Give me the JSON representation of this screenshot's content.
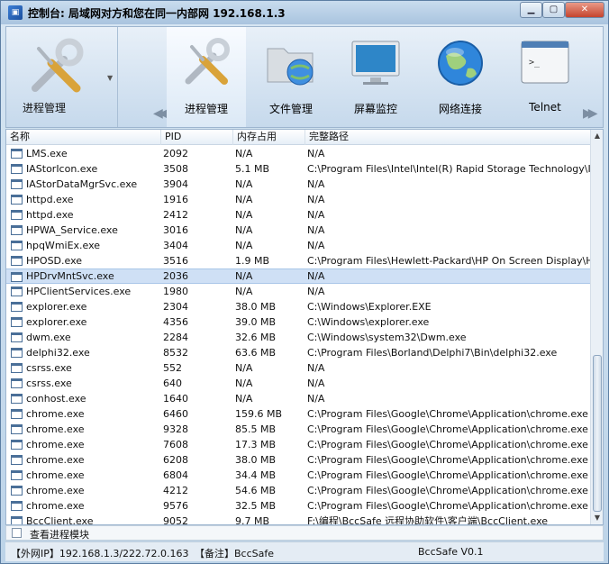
{
  "window": {
    "title": "控制台: 局域网对方和您在同一内部网   192.168.1.3"
  },
  "toolbar": {
    "main_tool": {
      "label": "进程管理",
      "icon": "tools-icon"
    },
    "tools": [
      {
        "label": "进程管理",
        "icon": "tools-icon",
        "selected": true
      },
      {
        "label": "文件管理",
        "icon": "folder-globe-icon",
        "selected": false
      },
      {
        "label": "屏幕监控",
        "icon": "monitor-icon",
        "selected": false
      },
      {
        "label": "网络连接",
        "icon": "globe-icon",
        "selected": false
      },
      {
        "label": "Telnet",
        "icon": "terminal-icon",
        "selected": false
      }
    ]
  },
  "table": {
    "columns": [
      "名称",
      "PID",
      "内存占用",
      "完整路径"
    ],
    "rows": [
      {
        "name": "LMS.exe",
        "pid": "2092",
        "mem": "N/A",
        "path": "N/A"
      },
      {
        "name": "IAStorIcon.exe",
        "pid": "3508",
        "mem": "5.1 MB",
        "path": "C:\\Program Files\\Intel\\Intel(R) Rapid Storage Technology\\IAStorI"
      },
      {
        "name": "IAStorDataMgrSvc.exe",
        "pid": "3904",
        "mem": "N/A",
        "path": "N/A"
      },
      {
        "name": "httpd.exe",
        "pid": "1916",
        "mem": "N/A",
        "path": "N/A"
      },
      {
        "name": "httpd.exe",
        "pid": "2412",
        "mem": "N/A",
        "path": "N/A"
      },
      {
        "name": "HPWA_Service.exe",
        "pid": "3016",
        "mem": "N/A",
        "path": "N/A"
      },
      {
        "name": "hpqWmiEx.exe",
        "pid": "3404",
        "mem": "N/A",
        "path": "N/A"
      },
      {
        "name": "HPOSD.exe",
        "pid": "3516",
        "mem": "1.9 MB",
        "path": "C:\\Program Files\\Hewlett-Packard\\HP On Screen Display\\HPOSD.e"
      },
      {
        "name": "HPDrvMntSvc.exe",
        "pid": "2036",
        "mem": "N/A",
        "path": "N/A",
        "selected": true
      },
      {
        "name": "HPClientServices.exe",
        "pid": "1980",
        "mem": "N/A",
        "path": "N/A"
      },
      {
        "name": "explorer.exe",
        "pid": "2304",
        "mem": "38.0 MB",
        "path": "C:\\Windows\\Explorer.EXE"
      },
      {
        "name": "explorer.exe",
        "pid": "4356",
        "mem": "39.0 MB",
        "path": "C:\\Windows\\explorer.exe"
      },
      {
        "name": "dwm.exe",
        "pid": "2284",
        "mem": "32.6 MB",
        "path": "C:\\Windows\\system32\\Dwm.exe"
      },
      {
        "name": "delphi32.exe",
        "pid": "8532",
        "mem": "63.6 MB",
        "path": "C:\\Program Files\\Borland\\Delphi7\\Bin\\delphi32.exe"
      },
      {
        "name": "csrss.exe",
        "pid": "552",
        "mem": "N/A",
        "path": "N/A"
      },
      {
        "name": "csrss.exe",
        "pid": "640",
        "mem": "N/A",
        "path": "N/A"
      },
      {
        "name": "conhost.exe",
        "pid": "1640",
        "mem": "N/A",
        "path": "N/A"
      },
      {
        "name": "chrome.exe",
        "pid": "6460",
        "mem": "159.6 MB",
        "path": "C:\\Program Files\\Google\\Chrome\\Application\\chrome.exe"
      },
      {
        "name": "chrome.exe",
        "pid": "9328",
        "mem": "85.5 MB",
        "path": "C:\\Program Files\\Google\\Chrome\\Application\\chrome.exe"
      },
      {
        "name": "chrome.exe",
        "pid": "7608",
        "mem": "17.3 MB",
        "path": "C:\\Program Files\\Google\\Chrome\\Application\\chrome.exe"
      },
      {
        "name": "chrome.exe",
        "pid": "6208",
        "mem": "38.0 MB",
        "path": "C:\\Program Files\\Google\\Chrome\\Application\\chrome.exe"
      },
      {
        "name": "chrome.exe",
        "pid": "6804",
        "mem": "34.4 MB",
        "path": "C:\\Program Files\\Google\\Chrome\\Application\\chrome.exe"
      },
      {
        "name": "chrome.exe",
        "pid": "4212",
        "mem": "54.6 MB",
        "path": "C:\\Program Files\\Google\\Chrome\\Application\\chrome.exe"
      },
      {
        "name": "chrome.exe",
        "pid": "9576",
        "mem": "32.5 MB",
        "path": "C:\\Program Files\\Google\\Chrome\\Application\\chrome.exe"
      },
      {
        "name": "BccClient.exe",
        "pid": "9052",
        "mem": "9.7 MB",
        "path": "F:\\编程\\BccSafe 远程协助软件\\客户端\\BccClient.exe"
      }
    ]
  },
  "module_toggle": {
    "label": "查看进程模块",
    "checked": false
  },
  "status": {
    "ip": "【外网IP】192.168.1.3/222.72.0.163",
    "note": "【备注】BccSafe",
    "version": "BccSafe  V0.1"
  },
  "colors": {
    "selected_row": "#cfe0f5",
    "accent": "#3c7fd6"
  }
}
